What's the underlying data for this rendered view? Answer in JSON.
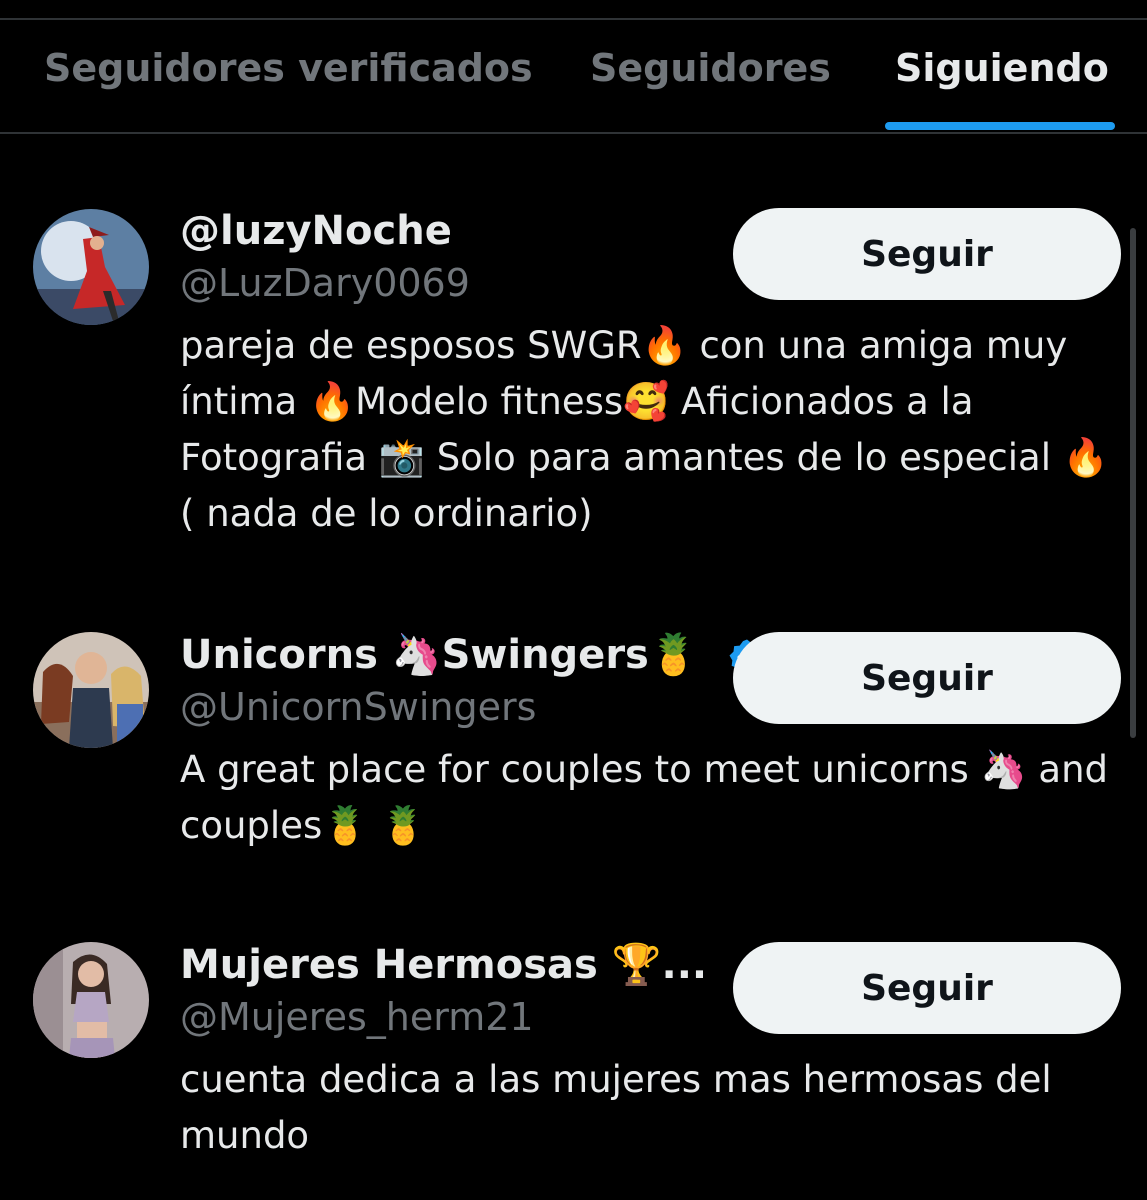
{
  "tabs": [
    {
      "label": "Seguidores verificados",
      "active": false
    },
    {
      "label": "Seguidores",
      "active": false
    },
    {
      "label": "Siguiendo",
      "active": true
    }
  ],
  "accent_color": "#1d9bf0",
  "users": [
    {
      "display_name": "@luzyNoche",
      "handle": "@LuzDary0069",
      "bio": "pareja de esposos SWGR🔥 con una amiga muy íntima 🔥Modelo fitness🥰 Aficionados a la Fotografia 📸 Solo para amantes de lo especial 🔥( nada de lo ordinario)",
      "follow_label": "Seguir",
      "verified": false
    },
    {
      "display_name": "Unicorns 🦄Swingers🍍",
      "handle": "@UnicornSwingers",
      "bio": "A great place for couples to meet unicorns 🦄 and couples🍍 🍍",
      "follow_label": "Seguir",
      "verified": true,
      "badge_icon": "verified-badge-icon"
    },
    {
      "display_name": "Mujeres Hermosas 🏆...",
      "handle": "@Mujeres_herm21",
      "bio": "cuenta dedica a las mujeres mas hermosas del mundo",
      "follow_label": "Seguir",
      "verified": false
    }
  ]
}
